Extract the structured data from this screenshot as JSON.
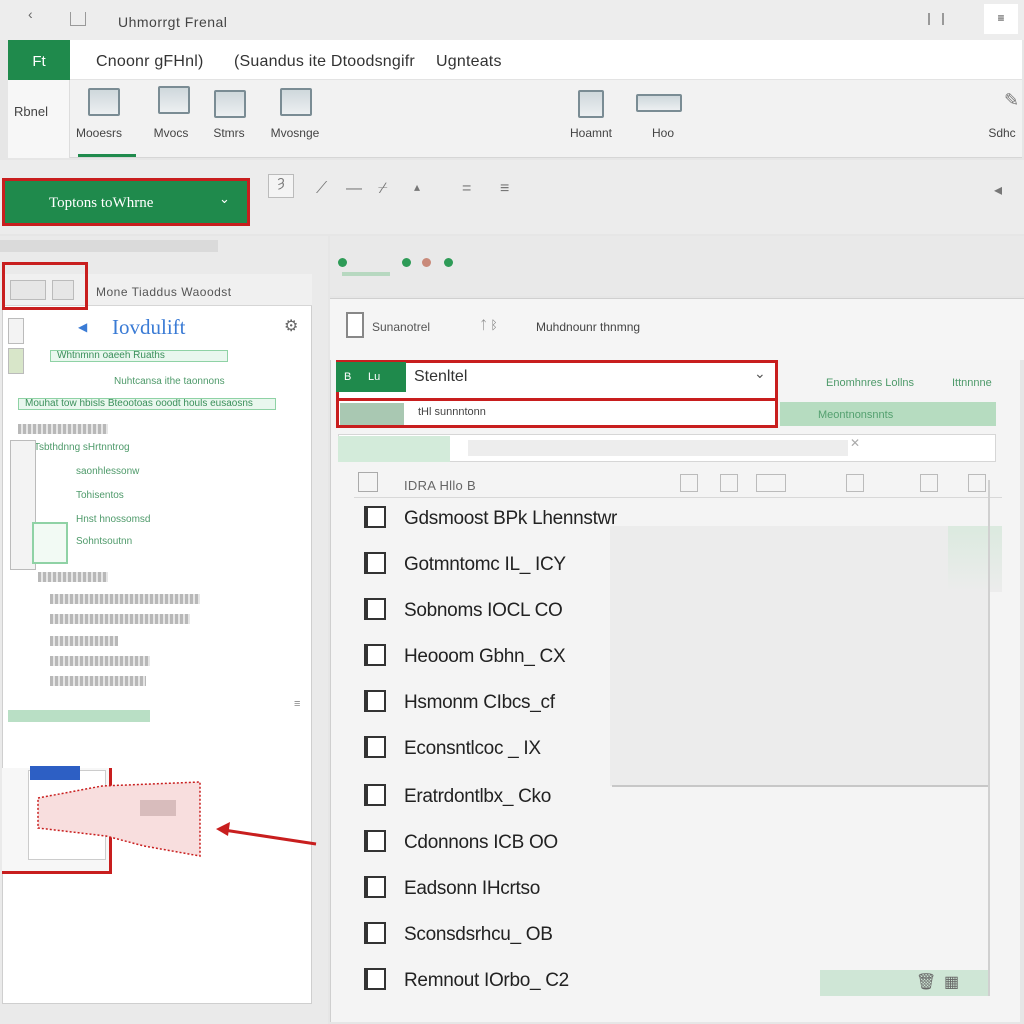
{
  "window": {
    "title": "Uhmorrgt  Frenal",
    "menu_icon": "≡",
    "back_icon": "‹"
  },
  "ribbon": {
    "file_tab": "Ft",
    "tabs": [
      "Cnoonr gFHnl)",
      "(Suandus ite Dtoodsngifr",
      "Ugnteats"
    ],
    "side_label": "Rbnel",
    "commands": [
      {
        "label": "Mooesrs",
        "icon": "table-icon"
      },
      {
        "label": "Mvocs",
        "icon": "grid-icon"
      },
      {
        "label": "Stmrs",
        "icon": "chart-icon"
      },
      {
        "label": "Mvosnge",
        "icon": "align-icon"
      },
      {
        "label": "Hoamnt",
        "icon": "org-chart-icon"
      },
      {
        "label": "Hoo",
        "icon": "list-icon"
      },
      {
        "label": "Sdhc",
        "icon": "pen-icon"
      }
    ]
  },
  "formula_bar": {
    "name_box": "Toptons toWhrne",
    "name_box_arrow": "⌄",
    "fx": "Ȝ",
    "glyphs": [
      "⟋",
      "—",
      "⌿",
      "▴",
      "=",
      "≡",
      "◂"
    ]
  },
  "left_panel": {
    "tabs_text": "Mone  Tiaddus  Waoodst",
    "title": "Iovdulift",
    "lines": [
      "Whtnmnn oaeeh Ruaths",
      "Nuhtcansa ithe taonnons",
      "Mouhat tow hbisls Bteootoas ooodt houls eusaosns",
      "Tsbthdnng  sHrtnntrog",
      "saonhlessonw",
      "Tohisentos",
      "Hnst hnossomsd",
      "Sohntsoutnn"
    ],
    "scroll_icon": "≡"
  },
  "dialog": {
    "header_left": "Sunanotrel",
    "header_glyph": "ᛏ  ᛒ",
    "header_right": "Muhdnounr thnmng",
    "dropdown": {
      "chip_a": "B",
      "chip_b": "Lu",
      "value": "Stenltel",
      "caret": "⌄",
      "row2": "tHl  sunnntonn"
    },
    "side_link_a": "Enomhnres Lollns",
    "side_link_b": "Ittnnnne",
    "green_band_text": "Meontnonsnnts",
    "list_header": "IDRA    Hllo  B",
    "items": [
      "Gdsmoost BPk  Lhennstwr",
      "Gotmntomc IL_ ICY",
      "Sobnoms IOCL  CO",
      "Heooom Gbhn_ CX",
      "Hsmonm CIbcs_cf",
      "Econsntlcoc _ IX",
      "Eratrdontlbx_ Cko",
      "Cdonnons ICB  OO",
      "Eadsonn IHcrtso",
      "Sconsdsrhcu_ OB",
      "Remnout IOrbo_ C2"
    ]
  },
  "colors": {
    "brand_green": "#1f8a4c",
    "highlight_red": "#c81e1e",
    "link_blue": "#3a7bd5"
  }
}
